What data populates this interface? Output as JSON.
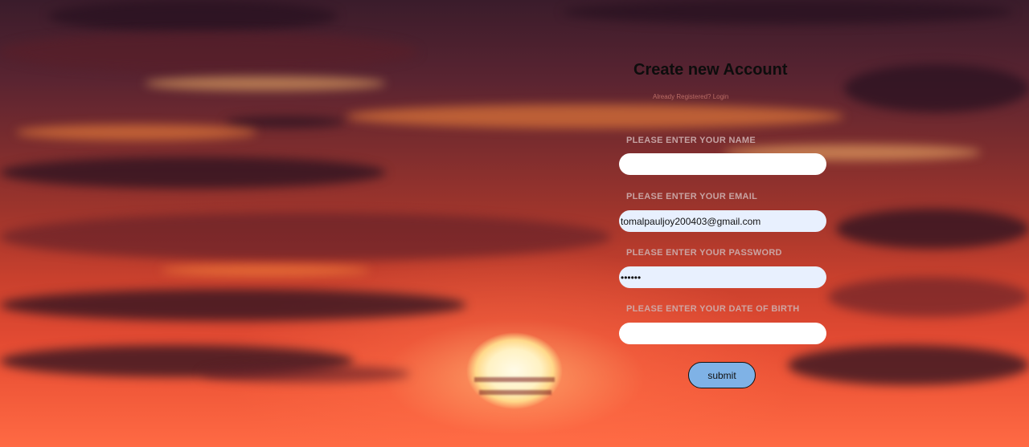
{
  "form": {
    "title": "Create new Account",
    "login_link": "Already Registered? Login",
    "fields": [
      {
        "label": "PLEASE ENTER YOUR NAME",
        "value": ""
      },
      {
        "label": "PLEASE ENTER YOUR EMAIL",
        "value": "tomalpauljoy200403@gmail.com"
      },
      {
        "label": "PLEASE ENTER YOUR PASSWORD",
        "value": "••••••"
      },
      {
        "label": "PLEASE ENTER YOUR DATE OF BIRTH",
        "value": ""
      }
    ],
    "submit_label": "submit"
  },
  "colors": {
    "submit_bg": "#7fb2e6",
    "autofill_bg": "#e8f0fe",
    "sky_top": "#3a1c2b",
    "sky_bottom": "#ff6a44"
  }
}
